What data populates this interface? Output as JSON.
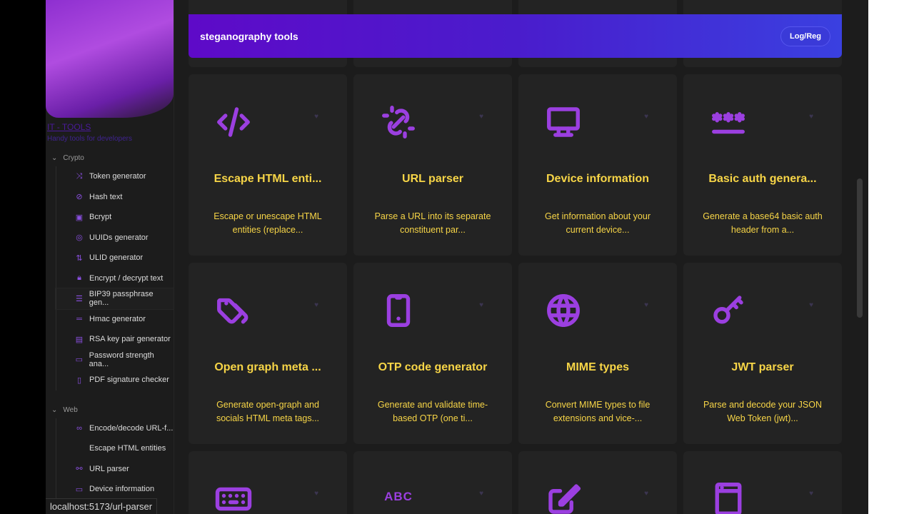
{
  "sidebar": {
    "brand": "IT - TOOLS",
    "tagline": "Handy tools for developers",
    "groups": [
      {
        "label": "Crypto",
        "items": [
          {
            "label": "Token generator",
            "icon": "shuffle-icon"
          },
          {
            "label": "Hash text",
            "icon": "eye-off-icon"
          },
          {
            "label": "Bcrypt",
            "icon": "box-icon"
          },
          {
            "label": "UUIDs generator",
            "icon": "fingerprint-icon"
          },
          {
            "label": "ULID generator",
            "icon": "sort-numeric-icon"
          },
          {
            "label": "Encrypt / decrypt text",
            "icon": "lock-icon"
          },
          {
            "label": "BIP39 passphrase gen...",
            "icon": "list-icon"
          },
          {
            "label": "Hmac generator",
            "icon": "short-text-icon"
          },
          {
            "label": "RSA key pair generator",
            "icon": "certificate-icon"
          },
          {
            "label": "Password strength ana...",
            "icon": "password-icon"
          },
          {
            "label": "PDF signature checker",
            "icon": "file-cert-icon"
          }
        ]
      },
      {
        "label": "Web",
        "items": [
          {
            "label": "Encode/decode URL-f...",
            "icon": "link-icon"
          },
          {
            "label": "Escape HTML entities",
            "icon": "code-icon"
          },
          {
            "label": "URL parser",
            "icon": "unlink-icon"
          },
          {
            "label": "Device information",
            "icon": "monitor-icon"
          }
        ]
      }
    ]
  },
  "banner": {
    "title": "steganography tools",
    "button": "Log/Reg"
  },
  "cards": [
    {
      "title": "Escape HTML enti...",
      "desc": "Escape or unescape HTML entities (replace...",
      "icon": "code-icon"
    },
    {
      "title": "URL parser",
      "desc": "Parse a URL into its separate constituent par...",
      "icon": "unlink-icon"
    },
    {
      "title": "Device information",
      "desc": "Get information about your current device...",
      "icon": "monitor-icon"
    },
    {
      "title": "Basic auth genera...",
      "desc": "Generate a base64 basic auth header from a...",
      "icon": "asterisk-password-icon"
    },
    {
      "title": "Open graph meta ...",
      "desc": "Generate open-graph and socials HTML meta tags...",
      "icon": "tags-icon"
    },
    {
      "title": "OTP code generator",
      "desc": "Generate and validate time-based OTP (one ti...",
      "icon": "phone-icon"
    },
    {
      "title": "MIME types",
      "desc": "Convert MIME types to file extensions and vice-...",
      "icon": "globe-icon"
    },
    {
      "title": "JWT parser",
      "desc": "Parse and decode your JSON Web Token (jwt)...",
      "icon": "key-icon"
    },
    {
      "title": "",
      "desc": "",
      "icon": "keyboard-icon"
    },
    {
      "title": "",
      "desc": "",
      "icon": "abc-icon",
      "glyph": "ABC"
    },
    {
      "title": "",
      "desc": "",
      "icon": "pencil-icon"
    },
    {
      "title": "",
      "desc": "",
      "icon": "browser-window-icon"
    }
  ],
  "status_url": "localhost:5173/url-parser"
}
